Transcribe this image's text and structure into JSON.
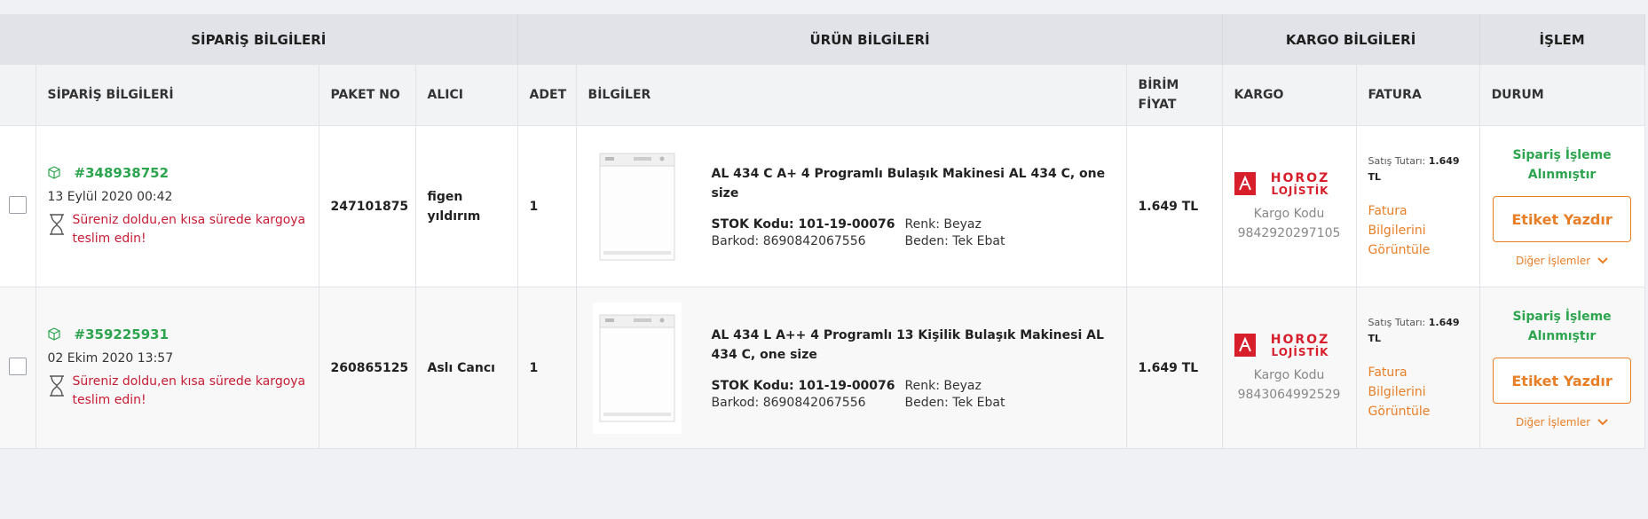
{
  "groups": {
    "siparis": "SİPARİŞ BİLGİLERİ",
    "urun": "ÜRÜN BİLGİLERİ",
    "kargo": "KARGO BİLGİLERİ",
    "islem": "İŞLEM"
  },
  "columns": {
    "siparis": "SİPARİŞ BİLGİLERİ",
    "paket": "PAKET NO",
    "alici": "ALICI",
    "adet": "ADET",
    "bilgiler": "BİLGİLER",
    "birim_fiyat": "BİRİM FİYAT",
    "kargo": "KARGO",
    "fatura": "FATURA",
    "durum": "DURUM"
  },
  "rows": [
    {
      "order_no": "#348938752",
      "date": "13 Eylül 2020 00:42",
      "warning": "Süreniz doldu,en kısa sürede kargoya teslim edin!",
      "package_no": "247101875",
      "recipient": "figen yıldırım",
      "qty": "1",
      "product_title": "AL 434 C A+ 4 Programlı Bulaşık Makinesi AL 434 C, one size",
      "stock_label": "STOK Kodu: 101-19-00076",
      "color": "Renk: Beyaz",
      "barcode": "Barkod: 8690842067556",
      "size": "Beden: Tek Ebat",
      "unit_price": "1.649 TL",
      "cargo_logo_top": "HOROZ",
      "cargo_logo_bottom": "LOJİSTİK",
      "cargo_code_label": "Kargo Kodu",
      "cargo_code": "9842920297105",
      "invoice_label": "Satış Tutarı:",
      "invoice_amount": "1.649",
      "invoice_currency": "TL",
      "invoice_link": "Fatura Bilgilerini Görüntüle",
      "status": "Sipariş İşleme Alınmıştır",
      "print_button": "Etiket Yazdır",
      "other_actions": "Diğer İşlemler"
    },
    {
      "order_no": "#359225931",
      "date": "02 Ekim 2020 13:57",
      "warning": "Süreniz doldu,en kısa sürede kargoya teslim edin!",
      "package_no": "260865125",
      "recipient": "Aslı Cancı",
      "qty": "1",
      "product_title": "AL 434 L A++ 4 Programlı 13 Kişilik Bulaşık Makinesi AL 434 C, one size",
      "stock_label": "STOK Kodu: 101-19-00076",
      "color": "Renk: Beyaz",
      "barcode": "Barkod: 8690842067556",
      "size": "Beden: Tek Ebat",
      "unit_price": "1.649 TL",
      "cargo_logo_top": "HOROZ",
      "cargo_logo_bottom": "LOJİSTİK",
      "cargo_code_label": "Kargo Kodu",
      "cargo_code": "9843064992529",
      "invoice_label": "Satış Tutarı:",
      "invoice_amount": "1.649",
      "invoice_currency": "TL",
      "invoice_link": "Fatura Bilgilerini Görüntüle",
      "status": "Sipariş İşleme Alınmıştır",
      "print_button": "Etiket Yazdır",
      "other_actions": "Diğer İşlemler"
    }
  ],
  "colors": {
    "green": "#2da44e",
    "orange": "#e87e26",
    "red": "#c71c34",
    "horoz_red": "#d71f2b"
  },
  "icons": {
    "order": "package-icon",
    "warning": "hourglass-icon",
    "more": "chevron-down-icon"
  }
}
